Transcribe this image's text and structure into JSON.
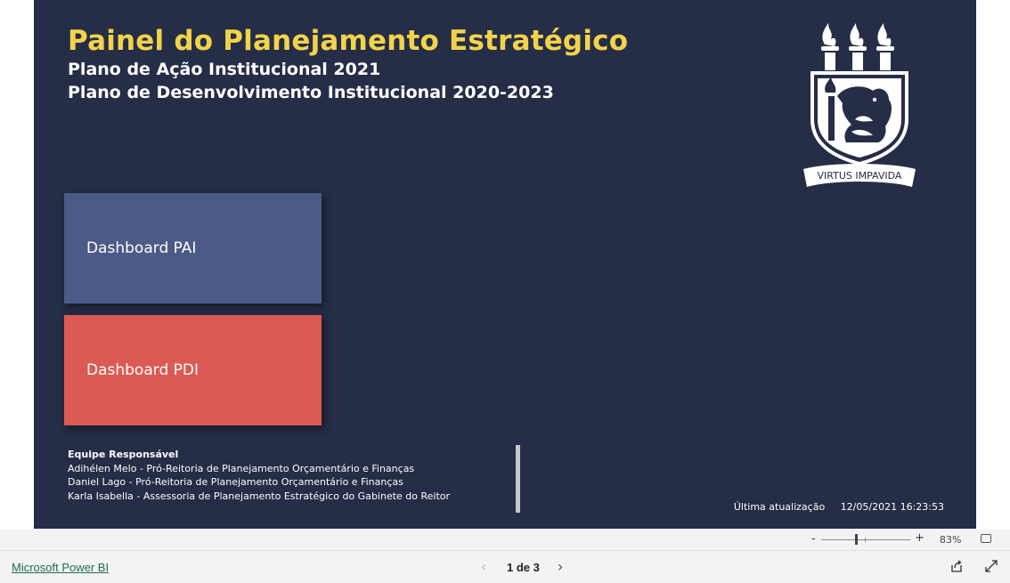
{
  "report": {
    "title": "Painel do Planejamento Estratégico",
    "subtitle_1": "Plano de Ação Institucional 2021",
    "subtitle_2": "Plano de Desenvolvimento Institucional 2020-2023",
    "logo_motto": "VIRTUS IMPAVIDA",
    "buttons": {
      "pai": "Dashboard PAI",
      "pdi": "Dashboard PDI"
    },
    "team": {
      "heading": "Equipe Responsável",
      "members": [
        "Adihélen Melo - Pró-Reitoria de Planejamento Orçamentário e Finanças",
        "Daniel Lago - Pró-Reitoria de Planejamento Orçamentário e Finanças",
        "Karla Isabella - Assessoria de Planejamento Estratégico do Gabinete do Reitor"
      ]
    },
    "last_update_label": "Última atualização",
    "last_update_value": "12/05/2021 16:23:53"
  },
  "zoom": {
    "minus": "-",
    "plus": "+",
    "percent": "83%"
  },
  "footer": {
    "brand_link": "Microsoft Power BI",
    "page_indicator": "1 de 3",
    "prev_icon": "‹",
    "next_icon": "›"
  },
  "colors": {
    "canvas_bg": "#252d47",
    "title": "#f3d34a",
    "pai_button": "#4c5a87",
    "pdi_button": "#dc5a54"
  },
  "icons": [
    "ufpe-crest-icon",
    "fit-page-icon",
    "share-icon",
    "fullscreen-icon"
  ]
}
